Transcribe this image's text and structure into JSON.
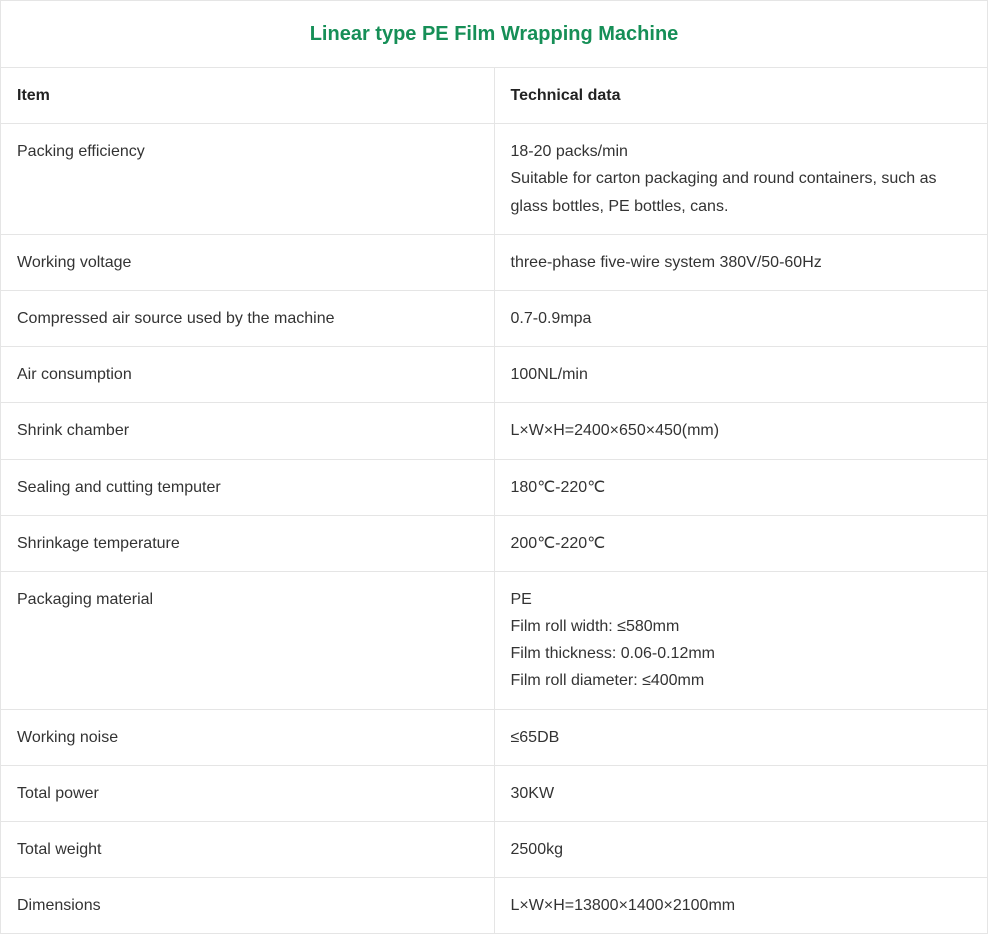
{
  "title": "Linear type PE Film Wrapping Machine",
  "headers": {
    "item": "Item",
    "data": "Technical data"
  },
  "rows": [
    {
      "item": "Packing efficiency",
      "data": [
        "18-20 packs/min",
        "Suitable for carton packaging and round containers, such as glass bottles, PE bottles, cans."
      ]
    },
    {
      "item": "Working voltage",
      "data": [
        "three-phase five-wire system 380V/50-60Hz"
      ]
    },
    {
      "item": "Compressed air source used by the machine",
      "data": [
        "0.7-0.9mpa"
      ]
    },
    {
      "item": "Air consumption",
      "data": [
        "100NL/min"
      ]
    },
    {
      "item": "Shrink chamber",
      "data": [
        "L×W×H=2400×650×450(mm)"
      ]
    },
    {
      "item": "Sealing and cutting temputer",
      "data": [
        "180℃-220℃"
      ]
    },
    {
      "item": "Shrinkage temperature",
      "data": [
        "200℃-220℃"
      ]
    },
    {
      "item": "Packaging material",
      "data": [
        "PE",
        "Film roll width: ≤580mm",
        "Film thickness: 0.06-0.12mm",
        "Film roll diameter: ≤400mm"
      ]
    },
    {
      "item": "Working noise",
      "data": [
        "≤65DB"
      ]
    },
    {
      "item": "Total power",
      "data": [
        "30KW"
      ]
    },
    {
      "item": "Total weight",
      "data": [
        "2500kg"
      ]
    },
    {
      "item": "Dimensions",
      "data": [
        "L×W×H=13800×1400×2100mm"
      ]
    }
  ]
}
